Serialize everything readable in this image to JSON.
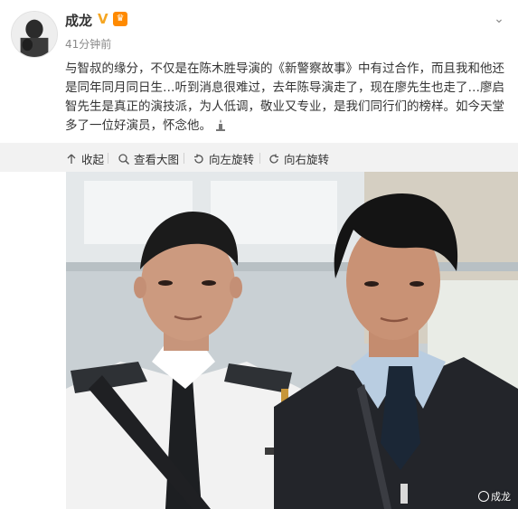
{
  "post": {
    "author": "成龙",
    "timestamp": "41分钟前",
    "text": "与智叔的缘分，不仅是在陈木胜导演的《新警察故事》中有过合作，而且我和他还是同年同月同日生…听到消息很难过，去年陈导演走了，现在廖先生也走了…廖启智先生是真正的演技派，为人低调，敬业又专业，是我们同行们的榜样。如今天堂多了一位好演员，怀念他。"
  },
  "actions": {
    "collapse": "收起",
    "view_large": "查看大图",
    "rotate_left": "向左旋转",
    "rotate_right": "向右旋转"
  },
  "photo": {
    "watermark": "成龙"
  },
  "colors": {
    "verified": "#f5a623",
    "action_bar_bg": "#f2f2f2"
  },
  "icons": [
    "verified-icon",
    "vip-icon",
    "chevron-down-icon",
    "collapse-icon",
    "zoom-icon",
    "rotate-left-icon",
    "rotate-right-icon",
    "candle-emoji-icon"
  ]
}
